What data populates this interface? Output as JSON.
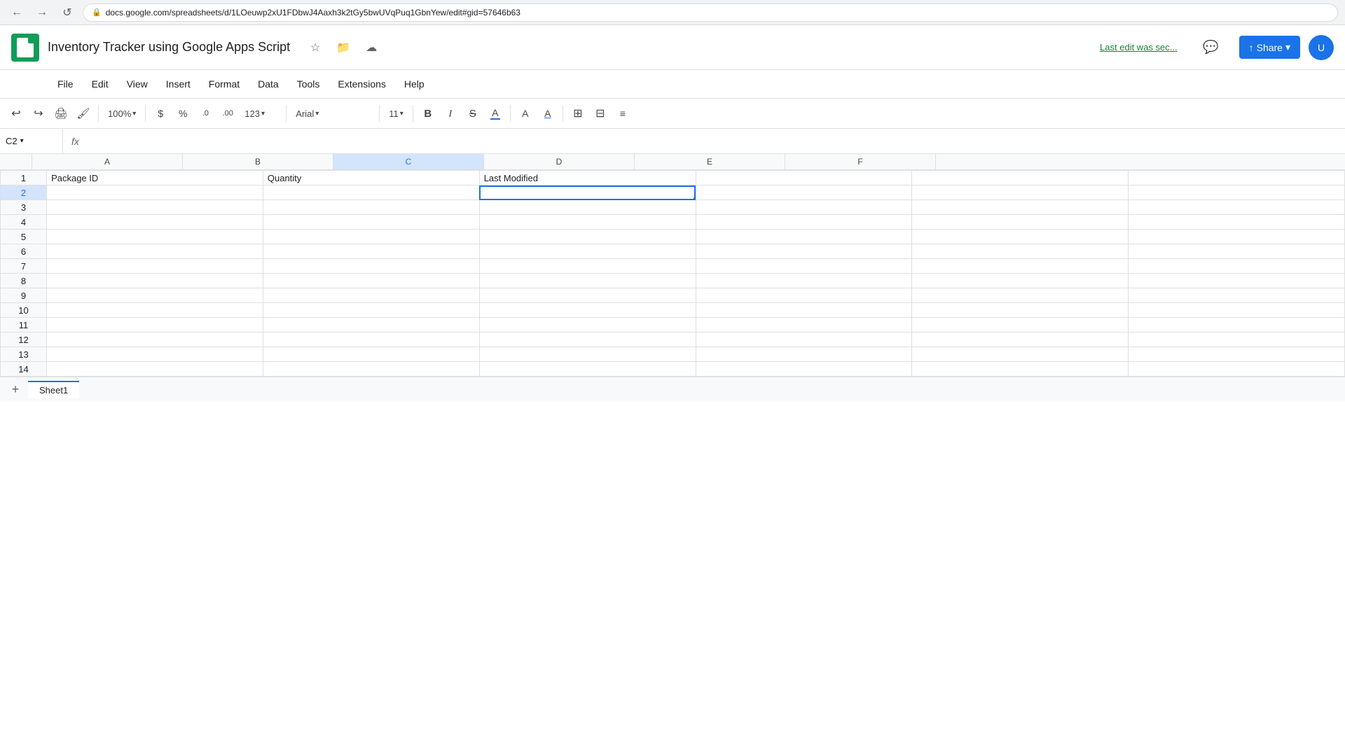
{
  "browser": {
    "url": "docs.google.com/spreadsheets/d/1LOeuwp2xU1FDbwJ4Aaxh3k2tGy5bwUVqPuq1GbnYew/edit#gid=57646b63",
    "back_label": "←",
    "forward_label": "→",
    "refresh_label": "↺",
    "lock_icon": "🔒"
  },
  "header": {
    "title": "Inventory Tracker using Google Apps Script",
    "star_icon": "☆",
    "folder_icon": "📁",
    "cloud_icon": "☁",
    "last_edit": "Last edit was sec...",
    "comment_icon": "💬",
    "share_label": "Share",
    "share_icon": "↑"
  },
  "menu": {
    "items": [
      "File",
      "Edit",
      "View",
      "Insert",
      "Format",
      "Data",
      "Tools",
      "Extensions",
      "Help"
    ]
  },
  "toolbar": {
    "undo_icon": "↩",
    "redo_icon": "↪",
    "print_icon": "🖨",
    "paint_icon": "🖌",
    "zoom_value": "100%",
    "currency_symbol": "$",
    "percent_symbol": "%",
    "decimal_decrease": ".0",
    "decimal_increase": ".00",
    "number_format": "123",
    "font_name": "",
    "font_size": "11",
    "bold_label": "B",
    "italic_label": "I",
    "strikethrough_label": "S",
    "underline_label": "A",
    "fill_color_icon": "A",
    "text_color_icon": "A",
    "borders_icon": "⊞",
    "merge_icon": "⊟"
  },
  "formula_bar": {
    "cell_ref": "C2",
    "fx_label": "fx"
  },
  "grid": {
    "columns": [
      "A",
      "B",
      "C",
      "D",
      "E",
      "F"
    ],
    "row_count": 14,
    "headers": {
      "A1": "Package ID",
      "B1": "Quantity",
      "C1": "Last Modified"
    },
    "selected_cell": "C2",
    "selected_col": "C",
    "selected_row": 2
  },
  "sheet_tabs": {
    "active_tab": "Sheet1",
    "tabs": [
      "Sheet1"
    ]
  }
}
